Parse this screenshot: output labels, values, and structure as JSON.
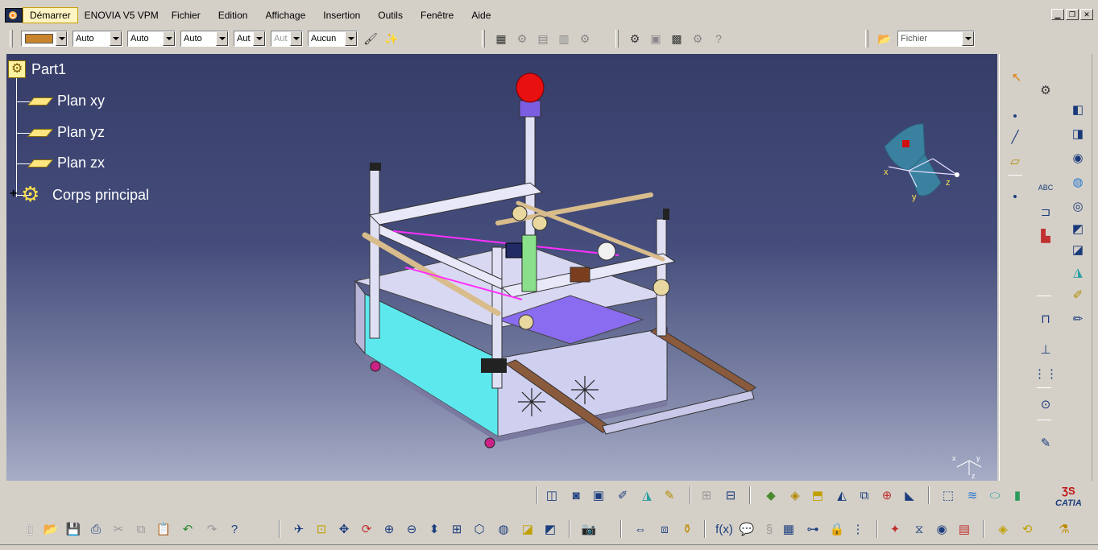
{
  "menubar": {
    "items": [
      "Démarrer",
      "ENOVIA V5 VPM",
      "Fichier",
      "Edition",
      "Affichage",
      "Insertion",
      "Outils",
      "Fenêtre",
      "Aide"
    ],
    "active_index": 0
  },
  "style_toolbar": {
    "color_swatch": "#c9852e",
    "combo1": "Auto",
    "combo2": "Auto",
    "combo3": "Auto",
    "combo4": "Aut",
    "combo5": "Aut",
    "combo6": "Aucun",
    "file_combo": "Fichier"
  },
  "tree": {
    "root": "Part1",
    "children": [
      "Plan xy",
      "Plan yz",
      "Plan zx"
    ],
    "body": "Corps principal"
  },
  "compass": {
    "x": "x",
    "y": "y",
    "z": "z"
  },
  "colors": {
    "viewport_top": "#363d68",
    "viewport_bottom": "#a7adc6",
    "ui_gray": "#d4d0c8",
    "machine_frame": "#c9c8e8",
    "panel_cyan": "#5de8ee",
    "beacon_red": "#e81010"
  },
  "brand": {
    "logo_text": "CATIA"
  }
}
